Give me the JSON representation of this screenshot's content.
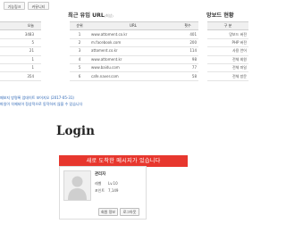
{
  "toolbar": {
    "btn1": "기능링크",
    "btn2": "커뮤니티"
  },
  "stats_table": {
    "header": "오늘",
    "values": [
      "3483",
      "5",
      "21",
      "1",
      "1",
      "354"
    ]
  },
  "referral": {
    "title": "최근 유입 URL",
    "subtitle": "(최상)",
    "headers": [
      "순위",
      "URL",
      "횟수"
    ],
    "rows": [
      [
        "1",
        "www.attoment.co.kr",
        "401"
      ],
      [
        "2",
        "m.facebook.com",
        "200"
      ],
      [
        "3",
        "attoment.co.kr",
        "114"
      ],
      [
        "4",
        "www.attoment.kr",
        "98"
      ],
      [
        "5",
        "www.baidu.com",
        "77"
      ],
      [
        "6",
        "cafe.naver.com",
        "58"
      ]
    ]
  },
  "server_info": {
    "title": "망보드 현황",
    "header": "구 분",
    "rows": [
      "망보드 버전",
      "PHP 버전",
      "사용 언어",
      "전체 회원",
      "전체 파일",
      "전체 방문"
    ]
  },
  "notices": {
    "line1": "페보지 방명록 업데이트 보어지오 (2017-05-31)",
    "line2": "파일이 삭제되어 정상적으로 동작하지 않을 수 있습니다"
  },
  "login": {
    "title": "Login",
    "alert": "새로 도착한 메시지가 있습니다",
    "name": "관리자",
    "level_label": "레벨",
    "level_value": "Lv.10",
    "point_label": "포인트",
    "point_value": "7,149",
    "btn_info": "회원 정보",
    "btn_logout": "로그아웃"
  }
}
